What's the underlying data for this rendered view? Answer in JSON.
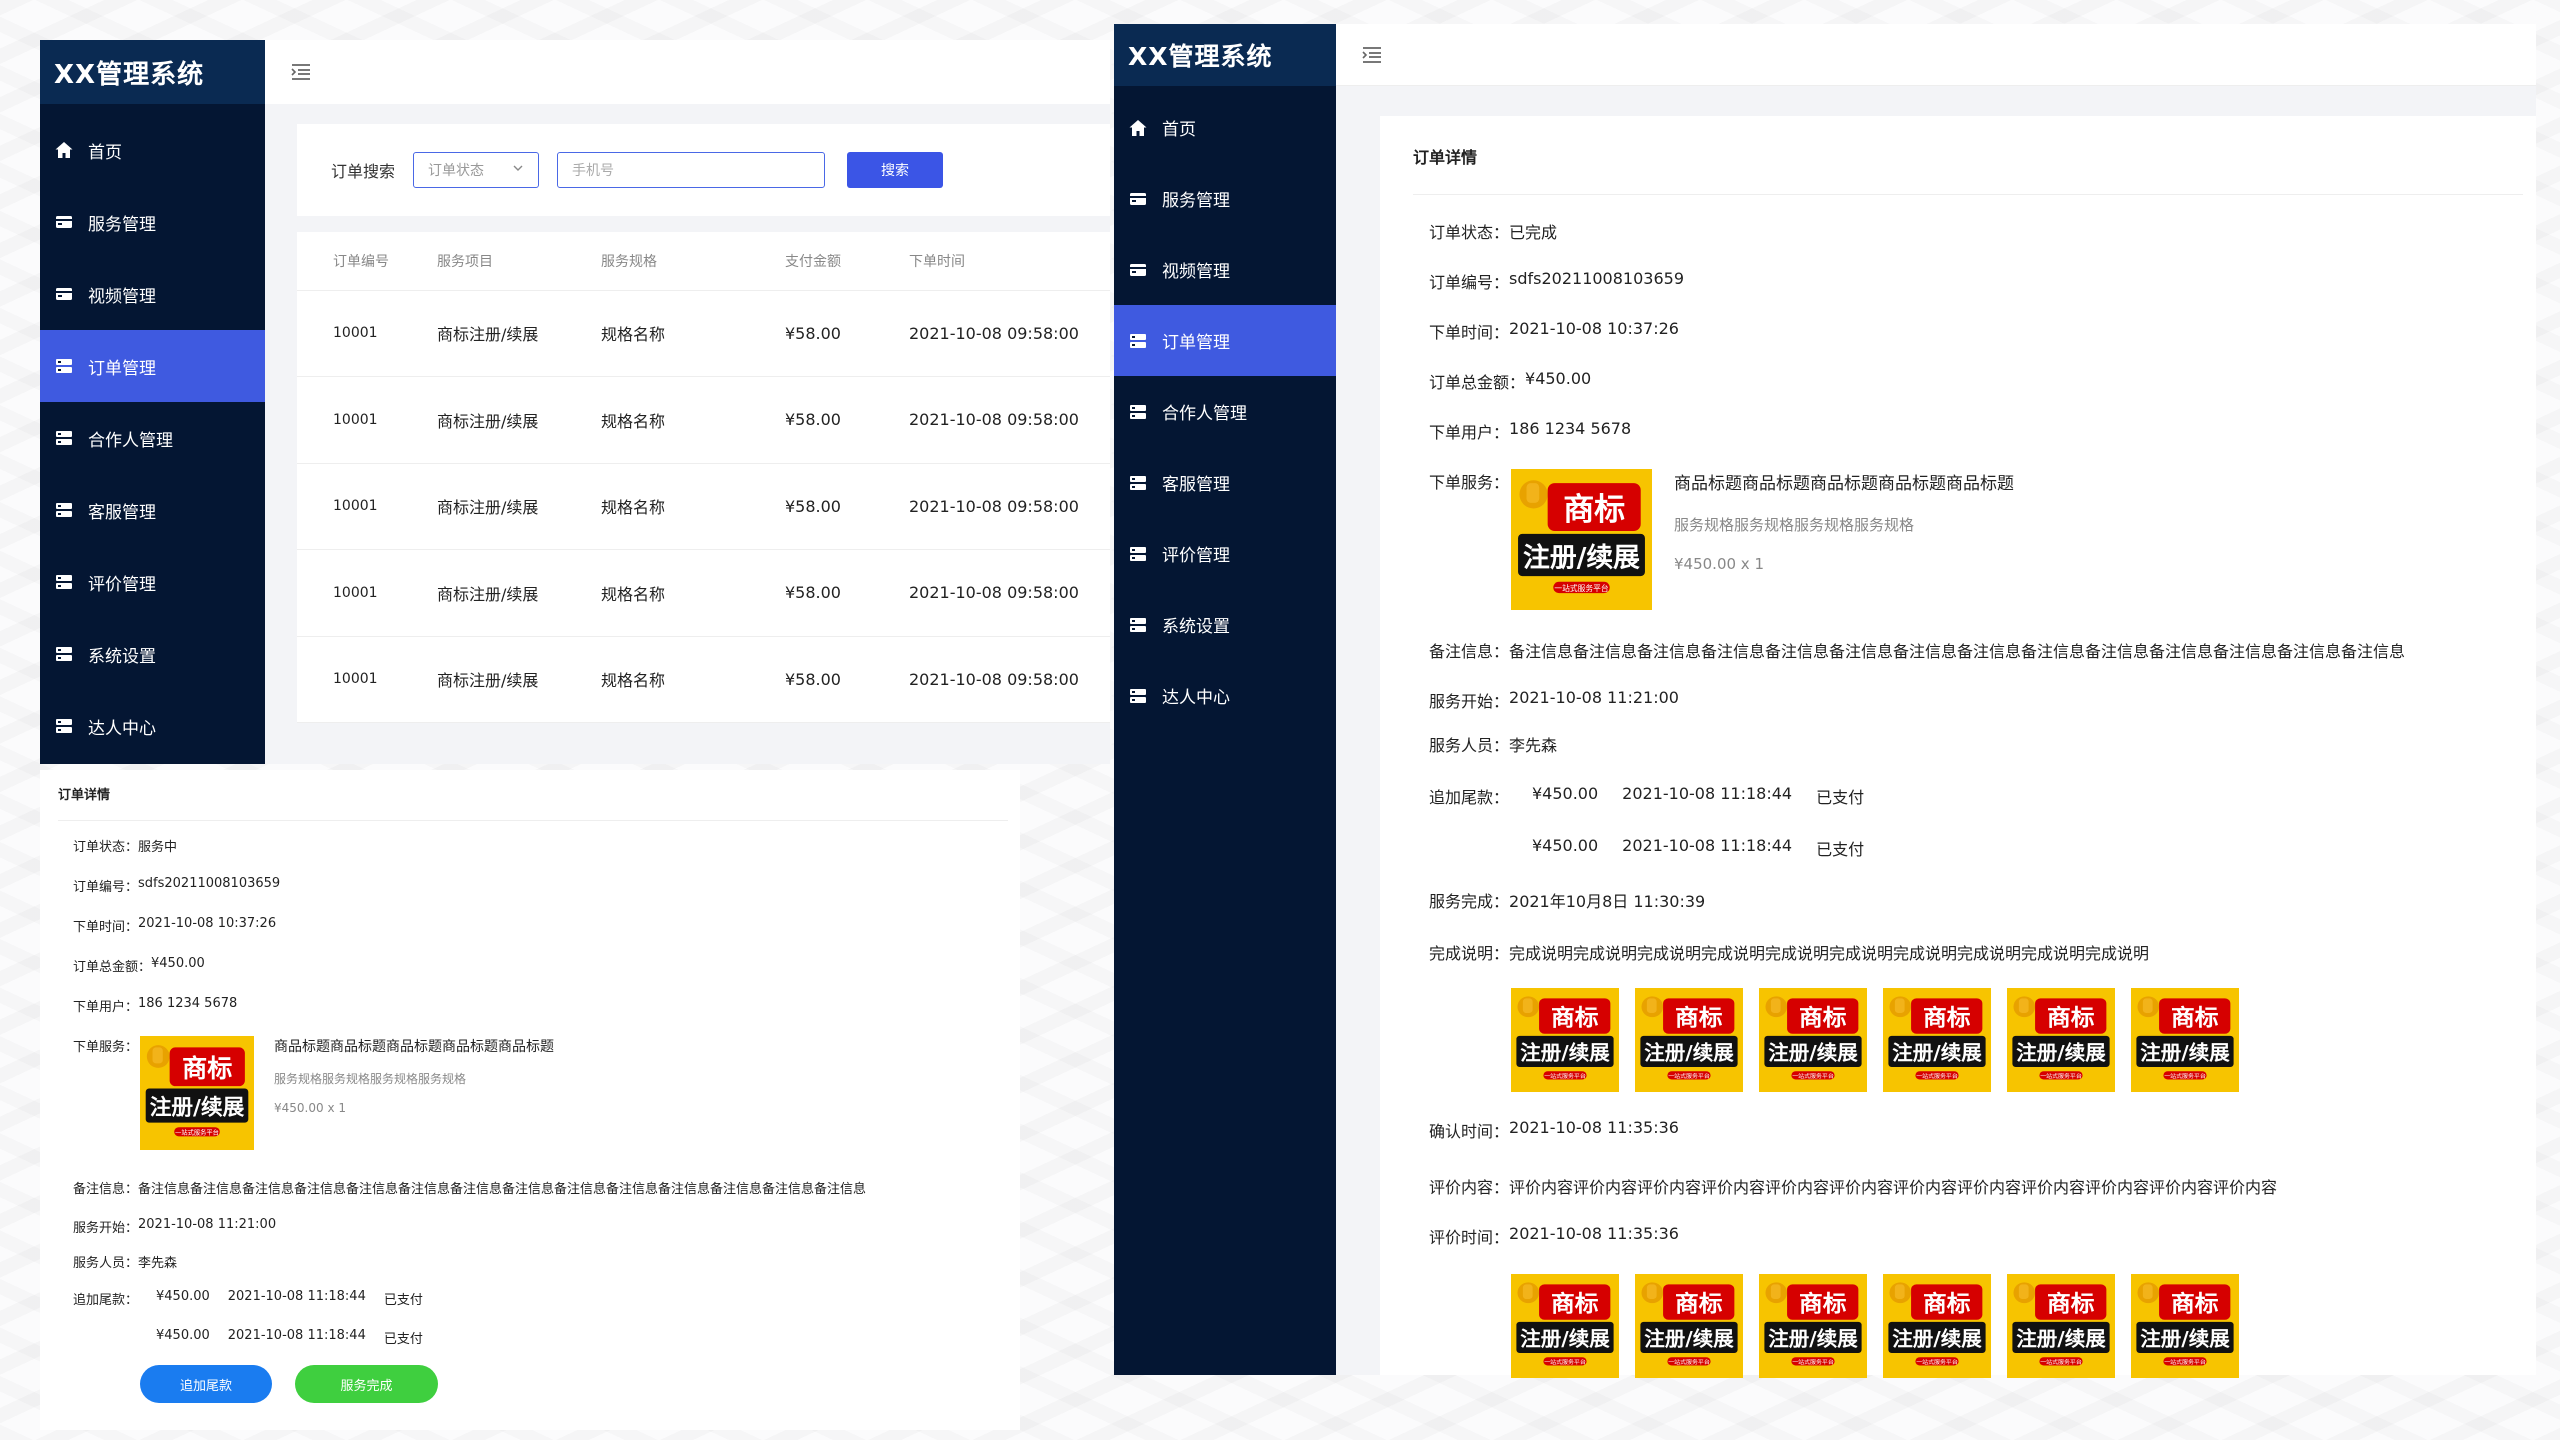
{
  "app": {
    "title": "XX管理系统"
  },
  "menu": [
    {
      "label": "首页",
      "icon": "home-icon"
    },
    {
      "label": "服务管理",
      "icon": "card-icon"
    },
    {
      "label": "视频管理",
      "icon": "card-icon"
    },
    {
      "label": "订单管理",
      "icon": "server-icon",
      "active": true
    },
    {
      "label": "合作人管理",
      "icon": "server-icon"
    },
    {
      "label": "客服管理",
      "icon": "server-icon"
    },
    {
      "label": "评价管理",
      "icon": "server-icon"
    },
    {
      "label": "系统设置",
      "icon": "server-icon"
    },
    {
      "label": "达人中心",
      "icon": "server-icon"
    }
  ],
  "search": {
    "label": "订单搜索",
    "status_placeholder": "订单状态",
    "phone_placeholder": "手机号",
    "button": "搜索"
  },
  "table": {
    "columns": [
      "订单编号",
      "服务项目",
      "服务规格",
      "支付金额",
      "下单时间"
    ],
    "rows": [
      [
        "10001",
        "商标注册/续展",
        "规格名称",
        "¥58.00",
        "2021-10-08 09:58:00"
      ],
      [
        "10001",
        "商标注册/续展",
        "规格名称",
        "¥58.00",
        "2021-10-08 09:58:00"
      ],
      [
        "10001",
        "商标注册/续展",
        "规格名称",
        "¥58.00",
        "2021-10-08 09:58:00"
      ],
      [
        "10001",
        "商标注册/续展",
        "规格名称",
        "¥58.00",
        "2021-10-08 09:58:00"
      ],
      [
        "10001",
        "商标注册/续展",
        "规格名称",
        "¥58.00",
        "2021-10-08 09:58:00"
      ]
    ]
  },
  "badge": {
    "line1": "商标",
    "line2": "注册/续展",
    "line3": "一站式服务平台"
  },
  "detail_left": {
    "title": "订单详情",
    "status_label": "订单状态：",
    "status": "服务中",
    "no_label": "订单编号：",
    "no": "sdfs20211008103659",
    "time_label": "下单时间：",
    "time": "2021-10-08 10:37:26",
    "amount_label": "订单总金额：",
    "amount": "¥450.00",
    "user_label": "下单用户：",
    "user": "186 1234 5678",
    "service_label": "下单服务：",
    "service_title": "商品标题商品标题商品标题商品标题商品标题",
    "service_spec": "服务规格服务规格服务规格服务规格",
    "service_price": "¥450.00 x 1",
    "remark_label": "备注信息：",
    "remark": "备注信息备注信息备注信息备注信息备注信息备注信息备注信息备注信息备注信息备注信息备注信息备注信息备注信息备注信息",
    "start_label": "服务开始：",
    "start": "2021-10-08 11:21:00",
    "staff_label": "服务人员：",
    "staff": "李先森",
    "extra_label": "追加尾款：",
    "extra": [
      {
        "amount": "¥450.00",
        "time": "2021-10-08 11:18:44",
        "status": "已支付"
      },
      {
        "amount": "¥450.00",
        "time": "2021-10-08 11:18:44",
        "status": "已支付"
      }
    ],
    "btn_add": "追加尾款",
    "btn_done": "服务完成"
  },
  "detail_right": {
    "title": "订单详情",
    "status_label": "订单状态：",
    "status": "已完成",
    "no_label": "订单编号：",
    "no": "sdfs20211008103659",
    "time_label": "下单时间：",
    "time": "2021-10-08 10:37:26",
    "amount_label": "订单总金额：",
    "amount": "¥450.00",
    "user_label": "下单用户：",
    "user": "186 1234 5678",
    "service_label": "下单服务：",
    "service_title": "商品标题商品标题商品标题商品标题商品标题",
    "service_spec": "服务规格服务规格服务规格服务规格",
    "service_price": "¥450.00 x 1",
    "remark_label": "备注信息：",
    "remark": "备注信息备注信息备注信息备注信息备注信息备注信息备注信息备注信息备注信息备注信息备注信息备注信息备注信息备注信息",
    "start_label": "服务开始：",
    "start": "2021-10-08 11:21:00",
    "staff_label": "服务人员：",
    "staff": "李先森",
    "extra_label": "追加尾款：",
    "extra": [
      {
        "amount": "¥450.00",
        "time": "2021-10-08 11:18:44",
        "status": "已支付"
      },
      {
        "amount": "¥450.00",
        "time": "2021-10-08 11:18:44",
        "status": "已支付"
      }
    ],
    "finish_label": "服务完成：",
    "finish": "2021年10月8日 11:30:39",
    "finish_note_label": "完成说明：",
    "finish_note": "完成说明完成说明完成说明完成说明完成说明完成说明完成说明完成说明完成说明完成说明",
    "confirm_label": "确认时间：",
    "confirm": "2021-10-08 11:35:36",
    "review_label": "评价内容：",
    "review": "评价内容评价内容评价内容评价内容评价内容评价内容评价内容评价内容评价内容评价内容评价内容评价内容",
    "review_time_label": "评价时间：",
    "review_time": "2021-10-08 11:35:36"
  },
  "colors": {
    "sidebar": "#041633",
    "brand_bg": "#0a2a52",
    "active": "#3f5ae0",
    "primary": "#3b55e6",
    "btn_add": "#1a7cf0",
    "btn_done": "#3fcf3f",
    "badge_yellow": "#f7c400"
  }
}
